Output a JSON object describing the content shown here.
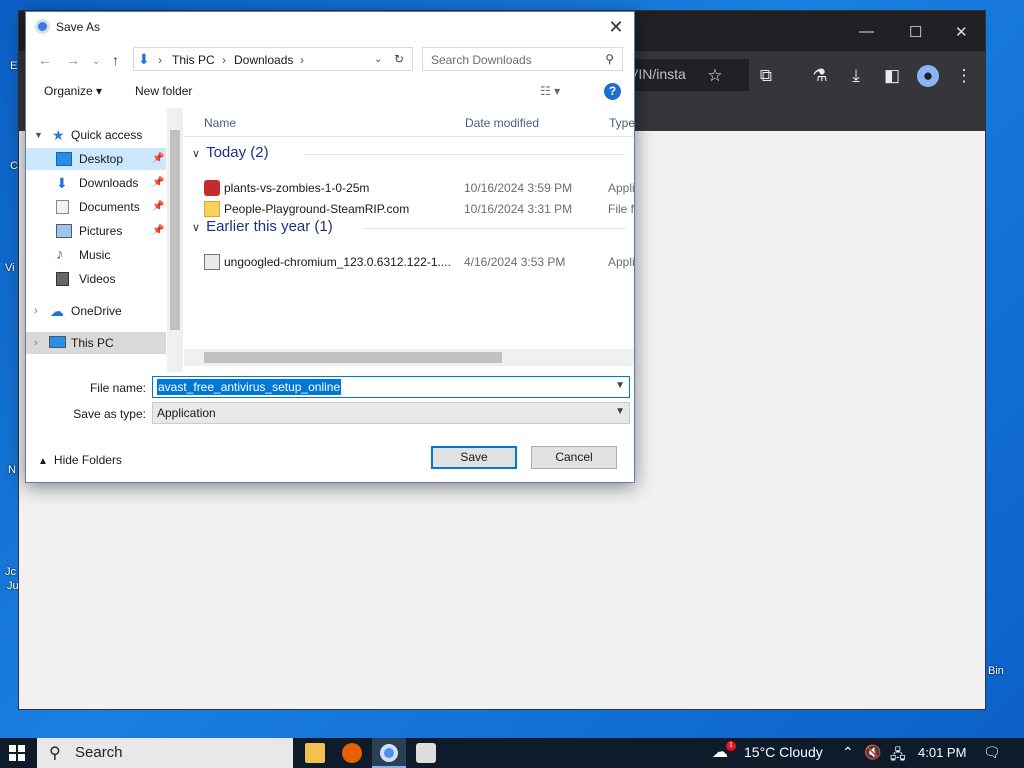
{
  "desktop": {
    "labels": [
      "E",
      "C",
      "Vi",
      "N",
      "Jc",
      "Ju",
      "Bin"
    ]
  },
  "chrome": {
    "omnibox_text": "VIN/insta",
    "window_controls": [
      "—",
      "☐",
      "✕"
    ]
  },
  "dialog": {
    "title": "Save As",
    "address": {
      "segments": [
        "This PC",
        "Downloads"
      ]
    },
    "search_placeholder": "Search Downloads",
    "commands": {
      "organize": "Organize",
      "new_folder": "New folder",
      "help": "?"
    },
    "nav": {
      "quick_access": "Quick access",
      "items": [
        {
          "label": "Desktop",
          "icon": "desktop-icon"
        },
        {
          "label": "Downloads",
          "icon": "downloads-icon"
        },
        {
          "label": "Documents",
          "icon": "documents-icon"
        },
        {
          "label": "Pictures",
          "icon": "pictures-icon"
        },
        {
          "label": "Music",
          "icon": "music-icon"
        },
        {
          "label": "Videos",
          "icon": "videos-icon"
        }
      ],
      "onedrive": "OneDrive",
      "this_pc": "This PC"
    },
    "columns": {
      "name": "Name",
      "date": "Date modified",
      "type": "Type"
    },
    "groups": [
      {
        "label": "Today (2)",
        "files": [
          {
            "name": "plants-vs-zombies-1-0-25m",
            "date": "10/16/2024 3:59 PM",
            "type": "Appli"
          },
          {
            "name": "People-Playground-SteamRIP.com",
            "date": "10/16/2024 3:31 PM",
            "type": "File fo"
          }
        ]
      },
      {
        "label": "Earlier this year (1)",
        "files": [
          {
            "name": "ungoogled-chromium_123.0.6312.122-1....",
            "date": "4/16/2024 3:53 PM",
            "type": "Appli"
          }
        ]
      }
    ],
    "file_name_label": "File name:",
    "file_name_value": "avast_free_antivirus_setup_online",
    "save_type_label": "Save as type:",
    "save_type_value": "Application",
    "hide_folders": "Hide Folders",
    "save_label": "Save",
    "cancel_label": "Cancel"
  },
  "taskbar": {
    "search": "Search",
    "weather": "15°C  Cloudy",
    "time": "4:01 PM",
    "notification_badge": "1"
  }
}
